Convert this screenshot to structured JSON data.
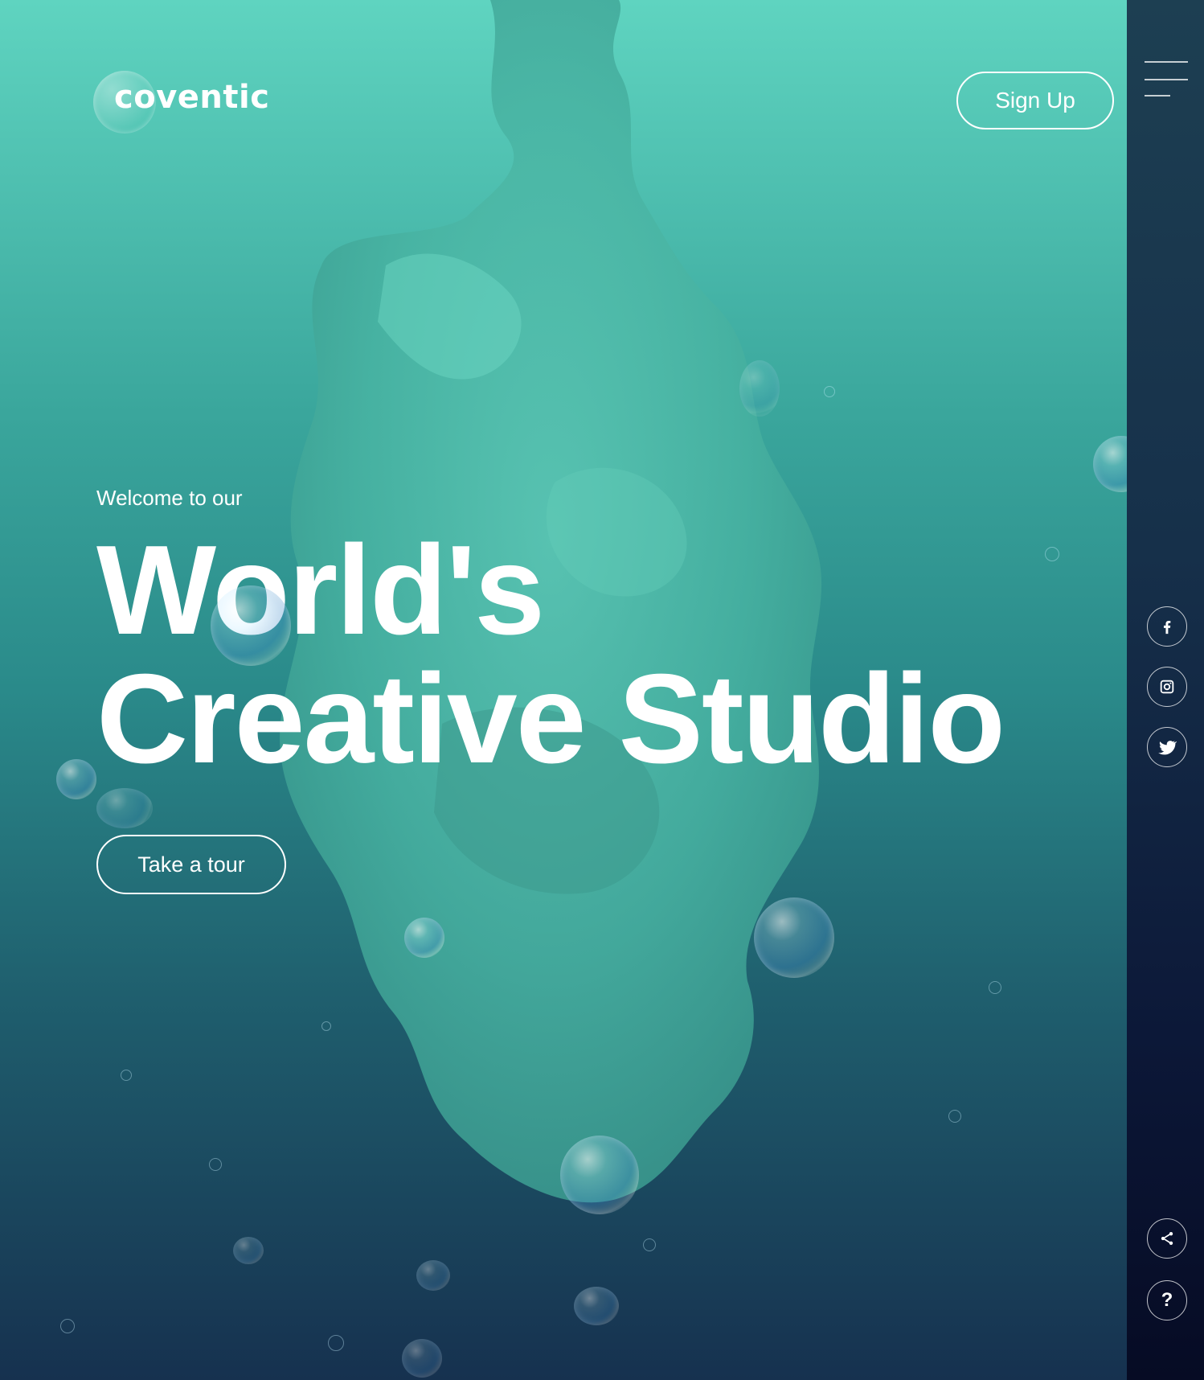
{
  "brand": {
    "name": "coventic"
  },
  "header": {
    "signup_label": "Sign Up"
  },
  "hero": {
    "welcome": "Welcome to our",
    "headline_line1": "World's",
    "headline_line2": "Creative Studio",
    "cta_label": "Take a tour"
  },
  "sidebar": {
    "menu_icon": "hamburger-menu-icon",
    "social_icons": [
      "facebook-icon",
      "instagram-icon",
      "twitter-icon"
    ],
    "utility_icons": [
      "share-icon",
      "help-icon"
    ],
    "help_glyph": "?"
  },
  "colors": {
    "hero_top": "#5fd4c0",
    "hero_bottom": "#16314f",
    "sidebar_bottom": "#060b24",
    "ink": "#46b8a8"
  }
}
